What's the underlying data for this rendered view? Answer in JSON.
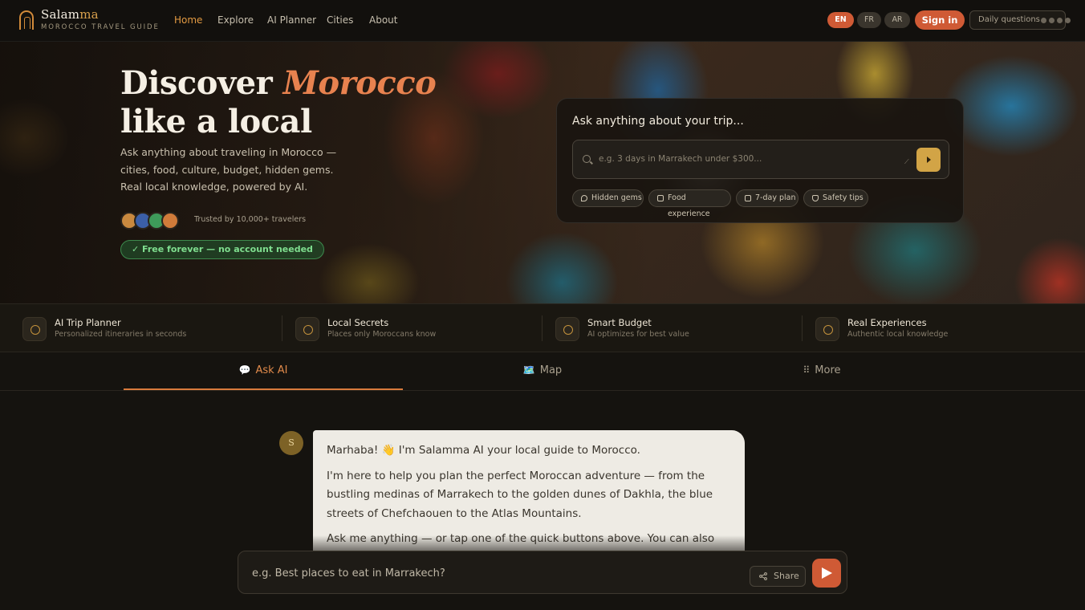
{
  "brand": {
    "name_main": "Salam",
    "name_accent": "ma",
    "subtitle": "MOROCCO TRAVEL GUIDE"
  },
  "nav": {
    "links": [
      "Home",
      "Explore",
      "AI Planner",
      "Cities",
      "About"
    ],
    "active": "Home"
  },
  "languages": [
    "EN",
    "FR",
    "AR"
  ],
  "active_language": "EN",
  "signin_label": "Sign in",
  "daily_questions_label": "Daily questions",
  "hero": {
    "title_line1_a": "Discover ",
    "title_line1_b": "Morocco",
    "title_line2": "like a local",
    "description": "Ask anything about traveling in Morocco — cities, food, culture, budget, hidden gems. Real local knowledge, powered by AI.",
    "trusted": "Trusted by 10,000+ travelers",
    "free_badge": "✓ Free forever — no account needed"
  },
  "ask_card": {
    "title": "Ask anything about your trip...",
    "placeholder": "e.g. 3 days in Marrakech under $300...",
    "chips": [
      "Hidden gems",
      "Food experience",
      "7-day plan",
      "Safety tips"
    ]
  },
  "features": [
    {
      "title": "AI Trip Planner",
      "subtitle": "Personalized itineraries in seconds",
      "icon": "star-icon"
    },
    {
      "title": "Local Secrets",
      "subtitle": "Places only Moroccans know",
      "icon": "pin-icon"
    },
    {
      "title": "Smart Budget",
      "subtitle": "AI optimizes for best value",
      "icon": "clock-icon"
    },
    {
      "title": "Real Experiences",
      "subtitle": "Authentic local knowledge",
      "icon": "people-icon"
    }
  ],
  "tabs": [
    {
      "label": "Ask AI",
      "icon": "💬"
    },
    {
      "label": "Map",
      "icon": "🗺️"
    },
    {
      "label": "More",
      "icon": "⠿"
    }
  ],
  "active_tab": "Ask AI",
  "chat": {
    "avatar_letter": "S",
    "messages": [
      "Marhaba! 👋 I'm Salamma AI your local guide to Morocco.",
      "I'm here to help you plan the perfect Moroccan adventure — from the bustling medinas of Marrakech to the golden dunes of Dakhla, the blue streets of Chefchaouen to the Atlas Mountains.",
      "Ask me anything — or tap one of the quick buttons above. You can also"
    ],
    "input_placeholder": "e.g. Best places to eat in Marrakech?",
    "share_label": "Share"
  },
  "colors": {
    "accent": "#cf5a35",
    "gold": "#d2a446",
    "background": "#15130f"
  }
}
